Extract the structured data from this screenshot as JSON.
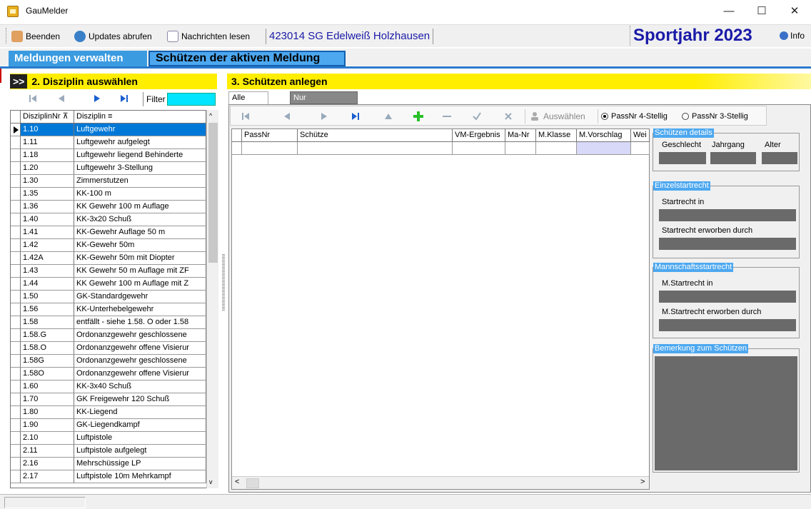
{
  "window": {
    "title": "GauMelder",
    "minimize": "—",
    "maximize": "☐",
    "close": "✕"
  },
  "toolbar": {
    "beenden": "Beenden",
    "updates": "Updates abrufen",
    "nachrichten": "Nachrichten lesen",
    "club": "423014  SG Edelweiß Holzhausen",
    "sportjahr": "Sportjahr 2023",
    "info": "Info"
  },
  "main_tabs": {
    "meldungen": "Meldungen verwalten",
    "schuetzen": "Schützen der aktiven Meldung"
  },
  "left": {
    "chev": ">>",
    "heading": "2. Disziplin auswählen",
    "filter_label": "Filter",
    "filter_value": "",
    "columns": [
      "DisziplinNr",
      "Disziplin"
    ],
    "rows": [
      [
        "1.10",
        "Luftgewehr"
      ],
      [
        "1.11",
        "Luftgewehr aufgelegt"
      ],
      [
        "1.18",
        "Luftgewehr liegend Behinderte"
      ],
      [
        "1.20",
        "Luftgewehr 3-Stellung"
      ],
      [
        "1.30",
        "Zimmerstutzen"
      ],
      [
        "1.35",
        "KK-100 m"
      ],
      [
        "1.36",
        "KK Gewehr 100 m Auflage"
      ],
      [
        "1.40",
        "KK-3x20 Schuß"
      ],
      [
        "1.41",
        "KK-Gewehr Auflage 50 m"
      ],
      [
        "1.42",
        "KK-Gewehr 50m"
      ],
      [
        "1.42A",
        "KK-Gewehr 50m mit Diopter"
      ],
      [
        "1.43",
        "KK Gewehr 50 m Auflage mit ZF"
      ],
      [
        "1.44",
        "KK Gewehr 100 m Auflage mit Z"
      ],
      [
        "1.50",
        "GK-Standardgewehr"
      ],
      [
        "1.56",
        "KK-Unterhebelgewehr"
      ],
      [
        "1.58",
        "entfällt - siehe 1.58. O oder 1.58"
      ],
      [
        "1.58.G",
        "Ordonanzgewehr geschlossene"
      ],
      [
        "1.58.O",
        "Ordonanzgewehr offene Visierur"
      ],
      [
        "1.58G",
        "Ordonanzgewehr geschlossene"
      ],
      [
        "1.58O",
        "Ordonanzgewehr offene Visierur"
      ],
      [
        "1.60",
        "KK-3x40 Schuß"
      ],
      [
        "1.70",
        "GK Freigewehr 120 Schuß"
      ],
      [
        "1.80",
        "KK-Liegend"
      ],
      [
        "1.90",
        "GK-Liegendkampf"
      ],
      [
        "2.10",
        "Luftpistole"
      ],
      [
        "2.11",
        "Luftpistole aufgelegt"
      ],
      [
        "2.16",
        "Mehrschüssige LP"
      ],
      [
        "2.17",
        "Luftpistole 10m Mehrkampf"
      ]
    ],
    "selected_index": 0
  },
  "right": {
    "heading": "3. Schützen anlegen",
    "tabs": [
      "Alle Schützen",
      "Nur Körperbehinderte Schützen"
    ],
    "auswaehlen": "Auswählen",
    "radio1": "PassNr 4-Stellig",
    "radio2": "PassNr 3-Stellig",
    "radio_selected": "PassNr 4-Stellig",
    "columns": [
      "PassNr",
      "Schütze",
      "VM-Ergebnis",
      "Ma-Nr",
      "M.Klasse",
      "M.Vorschlag",
      "Wei"
    ]
  },
  "details": {
    "schuetzen_details": "Schützen details",
    "geschlecht": "Geschlecht",
    "jahrgang": "Jahrgang",
    "alter": "Alter",
    "einzelstartrecht": "Einzelstartrecht",
    "startrecht_in": "Startrecht in",
    "startrecht_erworben": "Startrecht erworben durch",
    "mannschaftsstartrecht": "Mannschaftsstartrecht",
    "m_startrecht_in": "M.Startrecht in",
    "m_startrecht_erworben": "M.Startrecht erworben durch",
    "bemerkung": "Bemerkung zum Schützen"
  },
  "colors": {
    "accent_yellow": "#ffee00",
    "tab_blue": "#4da8f0",
    "selection": "#0078d7",
    "filter_cyan": "#00e5ff",
    "title_blue": "#1a1aa8"
  }
}
